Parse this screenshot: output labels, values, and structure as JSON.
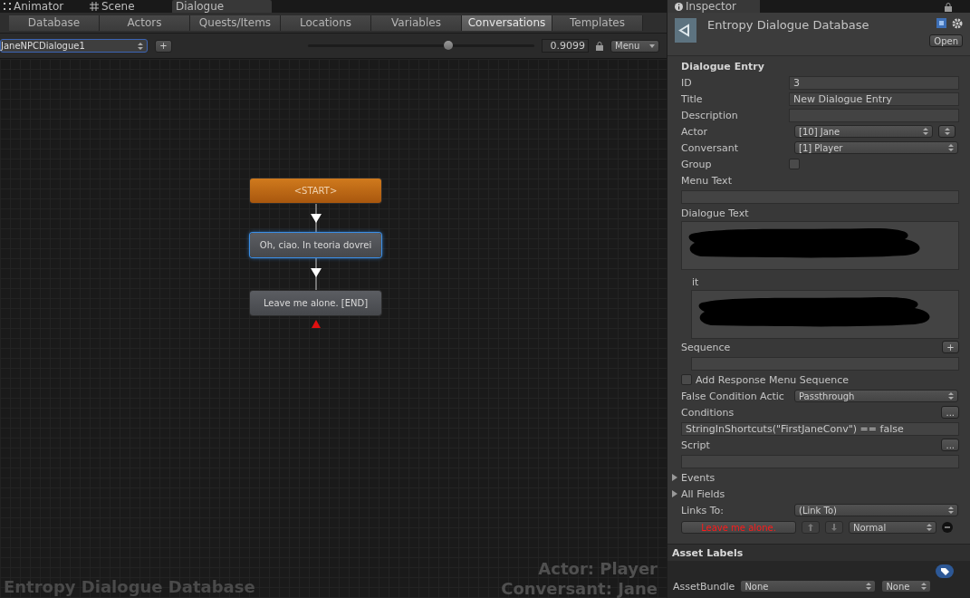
{
  "editor_tabs": [
    {
      "label": "Animator",
      "selected": false
    },
    {
      "label": "Scene",
      "selected": false
    },
    {
      "label": "Dialogue",
      "selected": true
    }
  ],
  "section_tabs": [
    {
      "label": "Database",
      "selected": false
    },
    {
      "label": "Actors",
      "selected": false
    },
    {
      "label": "Quests/Items",
      "selected": false
    },
    {
      "label": "Locations",
      "selected": false
    },
    {
      "label": "Variables",
      "selected": false
    },
    {
      "label": "Conversations",
      "selected": true
    },
    {
      "label": "Templates",
      "selected": false
    }
  ],
  "conversation_select": {
    "value": "JaneNPCDialogue1"
  },
  "add_button": "+",
  "zoom": {
    "level": 0.62,
    "reading": "0.9099"
  },
  "menu_button": "Menu",
  "nodes": [
    {
      "kind": "start",
      "text": "<START>",
      "selected": false
    },
    {
      "kind": "entry",
      "text": "Oh, ciao. In teoria dovrei",
      "selected": true
    },
    {
      "kind": "entry",
      "text": "Leave me alone. [END]",
      "selected": false
    }
  ],
  "canvas_labels": {
    "database": "Entropy  Dialogue Database",
    "actor": "Actor: Player",
    "conversant": "Conversant: Jane"
  },
  "inspector": {
    "tab": "Inspector",
    "asset_name": "Entropy  Dialogue Database",
    "open_button": "Open",
    "section": "Dialogue Entry",
    "fields": [
      {
        "kind": "text",
        "label": "ID",
        "value": "3"
      },
      {
        "kind": "text",
        "label": "Title",
        "value": "New Dialogue Entry"
      },
      {
        "kind": "text",
        "label": "Description"
      },
      {
        "kind": "dropdown",
        "label": "Actor",
        "value": "[10] Jane",
        "swap_button": true
      },
      {
        "kind": "dropdown",
        "label": "Conversant",
        "value": "[1] Player",
        "swap_button": false
      },
      {
        "kind": "checkbox",
        "label": "Group",
        "checked": false
      },
      {
        "kind": "block",
        "label": "Menu Text"
      },
      {
        "kind": "textarea",
        "label": "Dialogue Text"
      },
      {
        "kind": "localized",
        "label": "it"
      },
      {
        "kind": "sequence",
        "label": "Sequence",
        "button": "+"
      },
      {
        "kind": "check_row",
        "label": "Add Response Menu Sequence",
        "checked": false
      },
      {
        "kind": "dropdown",
        "label": "False Condition Actic",
        "value": "Passthrough",
        "swap_button": false
      },
      {
        "kind": "block",
        "label": "Conditions",
        "button": "...",
        "value": "StringInShortcuts(\"FirstJaneConv\") == false"
      },
      {
        "kind": "block",
        "label": "Script",
        "button": "..."
      },
      {
        "kind": "foldout",
        "label": "Events",
        "expanded": false
      },
      {
        "kind": "foldout",
        "label": "All Fields",
        "expanded": false
      },
      {
        "kind": "dropdown",
        "label": "Links To:",
        "value": "(Link To)",
        "swap_button": false
      },
      {
        "kind": "link",
        "target": "Leave me alone.",
        "priority": "Normal"
      }
    ]
  },
  "asset_labels": {
    "title": "Asset Labels",
    "bundle_label": "AssetBundle",
    "bundle": "None",
    "variant": "None"
  }
}
